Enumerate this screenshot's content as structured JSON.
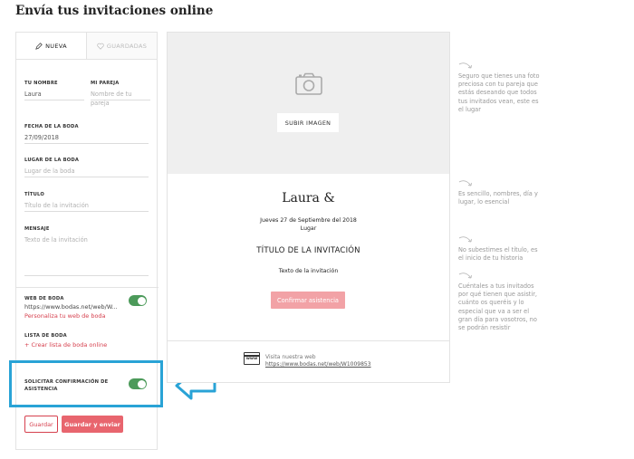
{
  "page_title": "Envía tus invitaciones online",
  "tabs": [
    {
      "label": "NUEVA",
      "icon": "pencil-icon",
      "active": true
    },
    {
      "label": "GUARDADAS",
      "icon": "heart-icon",
      "active": false
    }
  ],
  "form": {
    "tu_nombre": {
      "label": "TU NOMBRE",
      "value": "Laura"
    },
    "mi_pareja": {
      "label": "MI PAREJA",
      "placeholder": "Nombre de tu pareja"
    },
    "fecha": {
      "label": "FECHA DE LA BODA",
      "value": "27/09/2018"
    },
    "lugar": {
      "label": "LUGAR DE LA BODA",
      "placeholder": "Lugar de la boda"
    },
    "titulo": {
      "label": "TÍTULO",
      "placeholder": "Título de la invitación"
    },
    "mensaje": {
      "label": "MENSAJE",
      "placeholder": "Texto de la invitación"
    },
    "web": {
      "label": "WEB DE BODA",
      "url": "https://www.bodas.net/web/W...",
      "link": "Personaliza tu web de boda",
      "enabled": true
    },
    "lista": {
      "label": "LISTA DE BODA",
      "link": "+ Crear lista de boda online"
    },
    "confirmacion": {
      "label_line1": "SOLICITAR CONFIRMACIÓN DE",
      "label_line2": "ASISTENCIA",
      "enabled": true
    },
    "save_label": "Guardar",
    "save_send_label": "Guardar y enviar"
  },
  "preview": {
    "upload_label": "SUBIR IMAGEN",
    "names": "Laura &",
    "date": "Jueves 27 de Septiembre del 2018",
    "place": "Lugar",
    "title": "TÍTULO DE LA INVITACIÓN",
    "text": "Texto de la invitación",
    "confirm_label": "Confirmar asistencia",
    "www_icon_text": "www",
    "visit_label": "Visita nuestra web",
    "visit_url": "https://www.bodas.net/web/W1009853"
  },
  "hints": [
    "Seguro que tienes una foto preciosa con tu pareja que estás deseando que todos tus invitados vean, este es el lugar",
    "Es sencillo, nombres, día y lugar, lo esencial",
    "No subestimes el título, es el inicio de tu historia",
    "Cuéntales a tus invitados por qué tienen que asistir, cuánto os queréis y lo especial que va a ser el gran día para vosotros, no se podrán resistir"
  ],
  "colors": {
    "accent": "#d6404e",
    "button_primary": "#e8656e",
    "toggle_on": "#4c9a5a",
    "highlight": "#29a3d6"
  }
}
